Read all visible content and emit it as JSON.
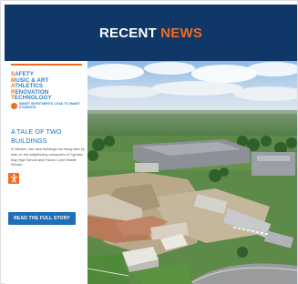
{
  "header": {
    "title_part1": "RECENT",
    "title_part2": "NEWS",
    "bg_color": "#0f3868",
    "accent_color": "#f26b21"
  },
  "logo": {
    "lines": [
      {
        "first": "S",
        "rest": "AFETY"
      },
      {
        "first": "M",
        "rest": "USIC & ART"
      },
      {
        "first": "A",
        "rest": "THLETICS"
      },
      {
        "first": "R",
        "rest": "ENOVATION"
      },
      {
        "first": "T",
        "rest": "ECHNOLOGY"
      }
    ],
    "tagline": "SMART INVESTMENTS. LEAD TO SMART STUDENTS.",
    "colors": {
      "primary": "#2f80c8",
      "accent": "#f26b21"
    }
  },
  "story": {
    "title": "A TALE OF TWO BUILDINGS",
    "body": "In Weston, two new buildings are rising side by side on the neighboring campuses of Cypress Bay High School and Falcon Cove Middle School."
  },
  "accessibility_button": {
    "icon": "accessibility-person-icon"
  },
  "read_button": {
    "label": "READ THE FULL STORY"
  },
  "photo": {
    "subject": "aerial-construction-site-photo"
  }
}
